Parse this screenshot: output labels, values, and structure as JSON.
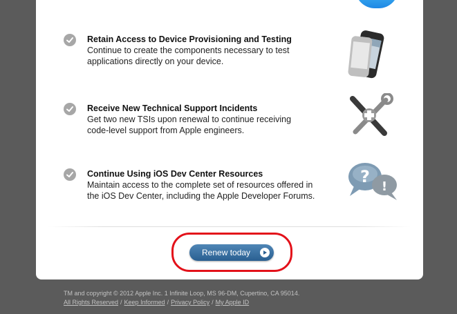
{
  "features": [
    {
      "title": "Retain Access to Device Provisioning and Testing",
      "description_lines": [
        "Continue to create the components necessary to test",
        "applications directly on your device."
      ],
      "illustration": "iphone-device-icon"
    },
    {
      "title": "Receive New Technical Support Incidents",
      "description_lines": [
        "Get two new TSIs upon renewal to continue receiving",
        "code-level support from Apple engineers."
      ],
      "illustration": "tools-plus-icon"
    },
    {
      "title": "Continue Using iOS Dev Center Resources",
      "description_lines": [
        "Maintain access to the complete set of resources offered in",
        "the iOS Dev Center, including the Apple Developer Forums."
      ],
      "illustration": "question-exclamation-bubbles-icon"
    }
  ],
  "renew_button": {
    "label": "Renew today"
  },
  "footer": {
    "copyright": "TM and copyright © 2012 Apple Inc. 1 Infinite Loop, MS 96-DM, Cupertino, CA 95014.",
    "links": [
      "All Rights Reserved",
      "Keep Informed",
      "Privacy Policy",
      "My Apple ID"
    ]
  },
  "colors": {
    "background": "#5b5b5b",
    "card": "#ffffff",
    "check": "#a7a7a7",
    "button": "#3a6fa3",
    "highlight": "#e3111a"
  }
}
